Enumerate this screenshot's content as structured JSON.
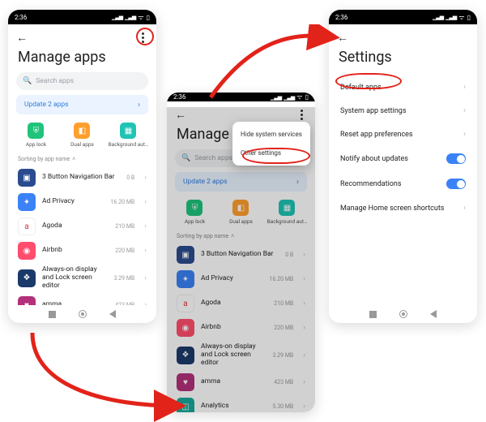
{
  "status": {
    "time": "2:36"
  },
  "manage": {
    "title": "Manage apps",
    "title_cut": "Manage ap",
    "search_placeholder": "Search apps",
    "update_text": "Update 2 apps",
    "shortcuts": {
      "applock": "App lock",
      "dual": "Dual apps",
      "bg": "Background aut…"
    },
    "sort_label": "Sorting by app name",
    "apps": [
      {
        "name": "3 Button Navigation Bar",
        "size": "0 B"
      },
      {
        "name": "Ad Privacy",
        "size": "16.20 MB"
      },
      {
        "name": "Agoda",
        "size": "210 MB"
      },
      {
        "name": "Airbnb",
        "size": "220 MB"
      },
      {
        "name": "Always-on display and Lock screen editor",
        "size": "3.29 MB"
      },
      {
        "name": "amma",
        "size": "423 MB"
      },
      {
        "name": "Analytics",
        "size": "5.30 MB"
      }
    ]
  },
  "popup": {
    "hide": "Hide system services",
    "other": "Other settings"
  },
  "settings": {
    "title": "Settings",
    "rows": {
      "default": "Default apps",
      "system": "System app settings",
      "reset": "Reset app preferences",
      "notify": "Notify about updates",
      "rec": "Recommendations",
      "home": "Manage Home screen shortcuts"
    }
  }
}
